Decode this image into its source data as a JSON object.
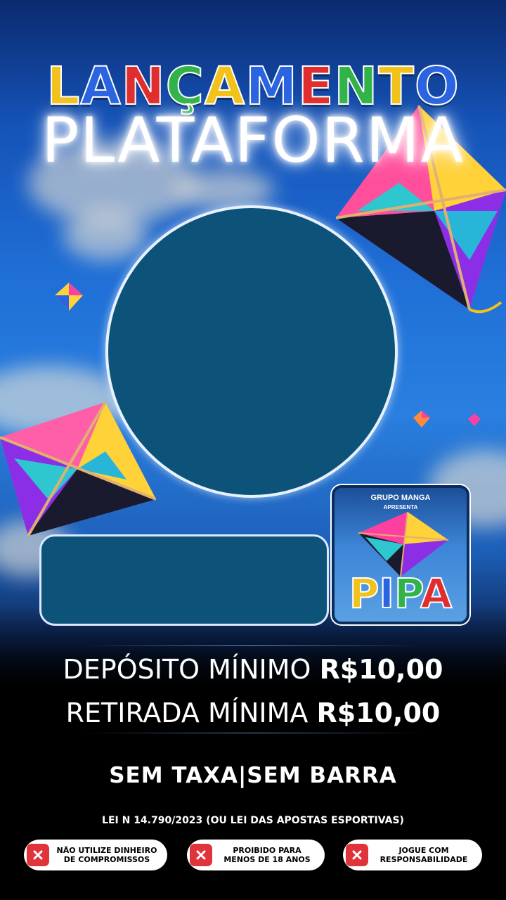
{
  "header": {
    "title_letters": [
      "L",
      "A",
      "N",
      "Ç",
      "A",
      "M",
      "E",
      "N",
      "T",
      "O"
    ],
    "subtitle": "PLATAFORMA"
  },
  "colors": {
    "title_letters": [
      "#f2c21c",
      "#2a64e0",
      "#e02e2e",
      "#32b34a",
      "#f2c21c",
      "#2a64e0",
      "#e02e2e",
      "#32b34a",
      "#f2c21c",
      "#2a64e0"
    ],
    "panel": "#0d5379",
    "warning_x": "#e0343b"
  },
  "logo": {
    "line1": "GRUPO MANGA",
    "line2": "APRESENTA",
    "word_letters": [
      "P",
      "I",
      "P",
      "A"
    ],
    "word_colors": [
      "#f2c21c",
      "#2a64e0",
      "#32b34a",
      "#e02e2e"
    ]
  },
  "info": {
    "deposit_label": "DEPÓSITO MÍNIMO",
    "deposit_value": "R$10,00",
    "withdraw_label": "RETIRADA MÍNIMA",
    "withdraw_value": "R$10,00",
    "no_fee": "SEM TAXA|SEM BARRA",
    "law": "LEI N 14.790/2023 (OU LEI DAS APOSTAS ESPORTIVAS)"
  },
  "warnings": [
    {
      "icon": "x-icon",
      "text": "NÃO UTILIZE DINHEIRO\nDE COMPROMISSOS"
    },
    {
      "icon": "x-icon",
      "text": "PROIBIDO PARA\nMENOS DE 18 ANOS"
    },
    {
      "icon": "x-icon",
      "text": "JOGUE COM\nRESPONSABILIDADE"
    }
  ]
}
